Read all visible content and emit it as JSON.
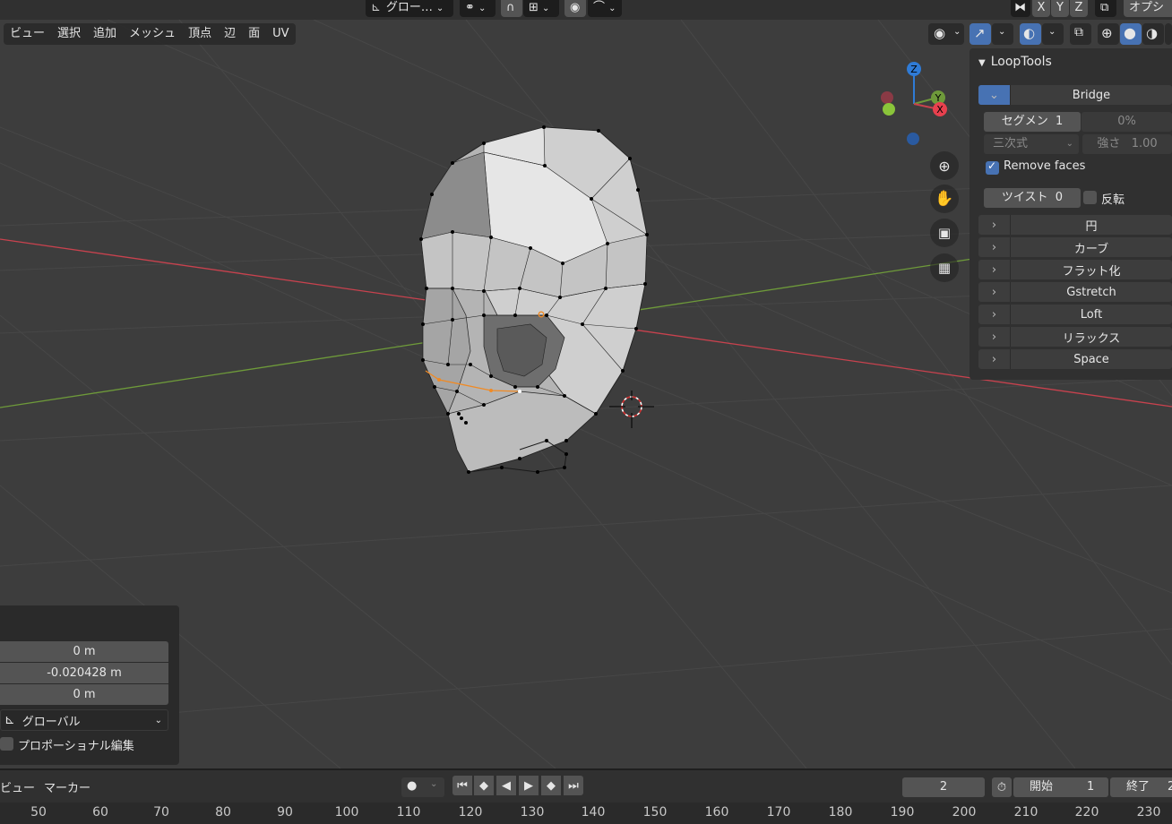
{
  "header": {
    "orientation_label": "グロー…",
    "axis_x": "X",
    "axis_y": "Y",
    "axis_z": "Z",
    "options_label": "オプシ"
  },
  "viewport_menu": {
    "items": [
      "ビュー",
      "選択",
      "追加",
      "メッシュ",
      "頂点",
      "辺",
      "面",
      "UV"
    ]
  },
  "gizmo": {
    "x": "X",
    "y": "Y",
    "z": "Z"
  },
  "looptools": {
    "title": "LoopTools",
    "bridge": {
      "label": "Bridge",
      "segments_label": "セグメン",
      "segments_value": "1",
      "min_width_value": "0%",
      "interpolation": "三次式",
      "strength_label": "強さ",
      "strength_value": "1.00",
      "remove_faces_label": "Remove faces",
      "remove_faces_checked": true,
      "twist_label": "ツイスト",
      "twist_value": "0",
      "reverse_label": "反転",
      "reverse_checked": false
    },
    "tools": [
      "円",
      "カーブ",
      "フラット化",
      "Gstretch",
      "Loft",
      "リラックス",
      "Space"
    ]
  },
  "last_operation": {
    "move_x": "0 m",
    "move_y": "-0.020428 m",
    "move_z": "0 m",
    "orientation": "グローバル",
    "proportional_label": "プロポーショナル編集"
  },
  "timeline": {
    "view_label": "ビュー",
    "marker_label": "マーカー",
    "current_frame": "2",
    "start_label": "開始",
    "start_value": "1",
    "end_label": "終了",
    "end_value": "2",
    "ruler_ticks": [
      "50",
      "60",
      "70",
      "80",
      "90",
      "100",
      "110",
      "120",
      "130",
      "140",
      "150",
      "160",
      "170",
      "180",
      "190",
      "200",
      "210",
      "220",
      "230"
    ]
  },
  "colors": {
    "accent": "#4772b3",
    "axis_x": "#c8424e",
    "axis_y": "#6e9a3a",
    "axis_z": "#2f7bd6",
    "selected": "#f08a24"
  }
}
